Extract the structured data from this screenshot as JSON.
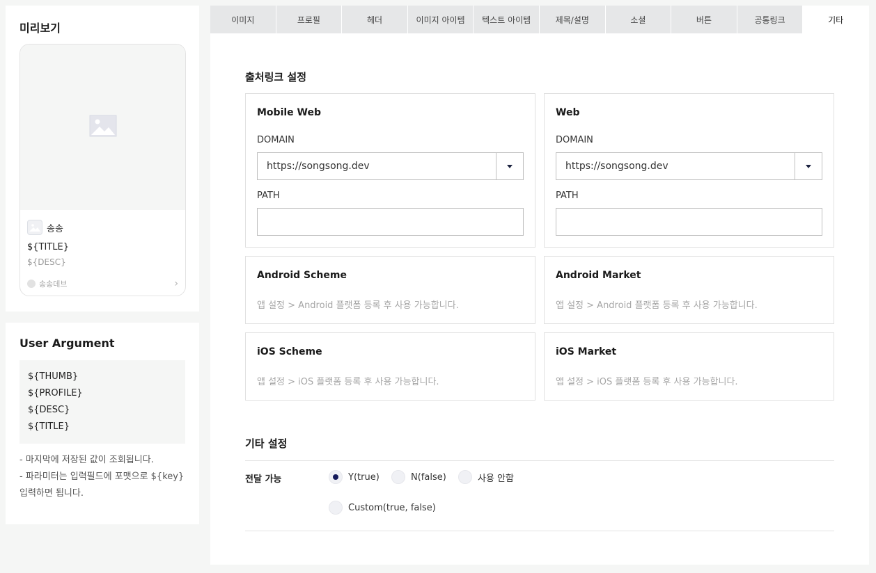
{
  "preview": {
    "title": "미리보기",
    "card": {
      "profile_name": "송송",
      "title": "${TITLE}",
      "desc": "${DESC}",
      "footer_name": "송송데브",
      "footer_chevron": "›"
    }
  },
  "user_argument": {
    "title": "User Argument",
    "args": [
      "${THUMB}",
      "${PROFILE}",
      "${DESC}",
      "${TITLE}"
    ],
    "notes": [
      "- 마지막에 저장된 값이 조회됩니다.",
      "- 파라미터는 입력필드에 포맷으로 ${key} 입력하면 됩니다."
    ]
  },
  "tabs": [
    {
      "label": "이미지",
      "active": false
    },
    {
      "label": "프로필",
      "active": false
    },
    {
      "label": "헤더",
      "active": false
    },
    {
      "label": "이미지 아이템",
      "active": false
    },
    {
      "label": "텍스트 아이템",
      "active": false
    },
    {
      "label": "제목/설명",
      "active": false
    },
    {
      "label": "소셜",
      "active": false
    },
    {
      "label": "버튼",
      "active": false
    },
    {
      "label": "공통링크",
      "active": false
    },
    {
      "label": "기타",
      "active": true
    }
  ],
  "source_link": {
    "title": "출처링크 설정",
    "mobile_web": {
      "title": "Mobile Web",
      "domain_label": "DOMAIN",
      "domain_value": "https://songsong.dev",
      "path_label": "PATH",
      "path_value": ""
    },
    "web": {
      "title": "Web",
      "domain_label": "DOMAIN",
      "domain_value": "https://songsong.dev",
      "path_label": "PATH",
      "path_value": ""
    },
    "android_scheme": {
      "title": "Android Scheme",
      "note": "앱 설정 > Android 플랫폼 등록 후 사용 가능합니다."
    },
    "android_market": {
      "title": "Android Market",
      "note": "앱 설정 > Android 플랫폼 등록 후 사용 가능합니다."
    },
    "ios_scheme": {
      "title": "iOS Scheme",
      "note": "앱 설정 > iOS 플랫폼 등록 후 사용 가능합니다."
    },
    "ios_market": {
      "title": "iOS Market",
      "note": "앱 설정 > iOS 플랫폼 등록 후 사용 가능합니다."
    }
  },
  "other_settings": {
    "title": "기타 설정",
    "forwardable_label": "전달 가능",
    "options": [
      {
        "label": "Y(true)",
        "selected": true
      },
      {
        "label": "N(false)",
        "selected": false
      },
      {
        "label": "사용 안함",
        "selected": false
      },
      {
        "label": "Custom(true, false)",
        "selected": false
      }
    ]
  },
  "colors": {
    "radio_selected": "#14195a",
    "tab_inactive_bg": "#e6e7e8",
    "page_bg": "#f5f6f5"
  },
  "icons": {
    "preview_image": "image-placeholder-icon",
    "dropdown": "caret-down-icon",
    "footer": "chevron-right-icon"
  }
}
